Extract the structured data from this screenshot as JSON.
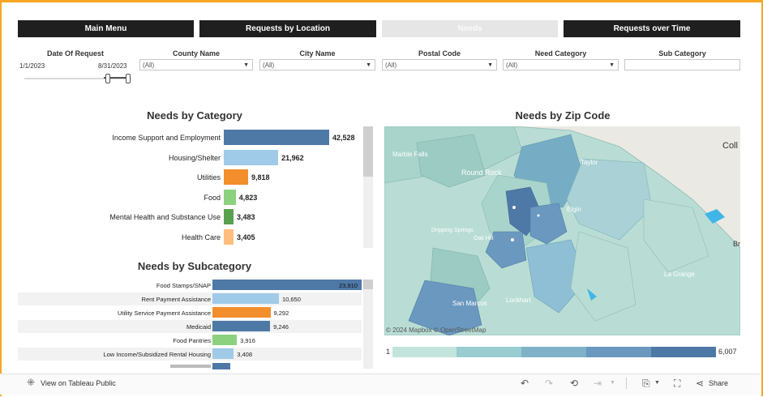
{
  "nav": {
    "main_menu": "Main Menu",
    "requests_by_location": "Requests by Location",
    "needs": "Needs",
    "requests_over_time": "Requests over Time"
  },
  "filters": {
    "date_label": "Date Of Request",
    "date_start": "1/1/2023",
    "date_end": "8/31/2023",
    "county_label": "County Name",
    "county_value": "(All)",
    "city_label": "City Name",
    "city_value": "(All)",
    "postal_label": "Postal Code",
    "postal_value": "(All)",
    "need_label": "Need Category",
    "need_value": "(All)",
    "sub_label": "Sub Category",
    "sub_value": ""
  },
  "needs_by_category": {
    "title": "Needs by Category",
    "items": [
      {
        "label": "Income Support and Employment",
        "value": "42,528",
        "num": 42528,
        "color": "#4e79a7"
      },
      {
        "label": "Housing/Shelter",
        "value": "21,962",
        "num": 21962,
        "color": "#a0cbe8"
      },
      {
        "label": "Utilities",
        "value": "9,818",
        "num": 9818,
        "color": "#f28e2b"
      },
      {
        "label": "Food",
        "value": "4,823",
        "num": 4823,
        "color": "#8cd17d"
      },
      {
        "label": "Mental Health and Substance Use",
        "value": "3,483",
        "num": 3483,
        "color": "#59a14f"
      },
      {
        "label": "Health Care",
        "value": "3,405",
        "num": 3405,
        "color": "#ffbe7d"
      }
    ]
  },
  "needs_by_subcategory": {
    "title": "Needs by Subcategory",
    "items": [
      {
        "label": "Food Stamps/SNAP",
        "value": "23,910",
        "num": 23910,
        "color": "#4e79a7"
      },
      {
        "label": "Rent Payment Assistance",
        "value": "10,650",
        "num": 10650,
        "color": "#a0cbe8"
      },
      {
        "label": "Utility Service Payment Assistance",
        "value": "9,292",
        "num": 9292,
        "color": "#f28e2b"
      },
      {
        "label": "Medicaid",
        "value": "9,246",
        "num": 9246,
        "color": "#4e79a7"
      },
      {
        "label": "Food Pantries",
        "value": "3,916",
        "num": 3916,
        "color": "#8cd17d"
      },
      {
        "label": "Low Income/Subsidized Rental Housing",
        "value": "3,408",
        "num": 3408,
        "color": "#a0cbe8"
      }
    ]
  },
  "map": {
    "title": "Needs by Zip Code",
    "attribution": "© 2024 Mapbox  © OpenStreetMap",
    "place_labels": [
      "Round Rock",
      "Taylor",
      "Elgin",
      "Marble Falls",
      "Oak Hill",
      "Dripping Springs",
      "Lockhart",
      "La Grange",
      "San Marcos"
    ],
    "edge_labels": [
      "Coll",
      "Br"
    ],
    "legend_min": "1",
    "legend_max": "6,007"
  },
  "footer": {
    "tableau_link": "View on Tableau Public",
    "share": "Share"
  }
}
